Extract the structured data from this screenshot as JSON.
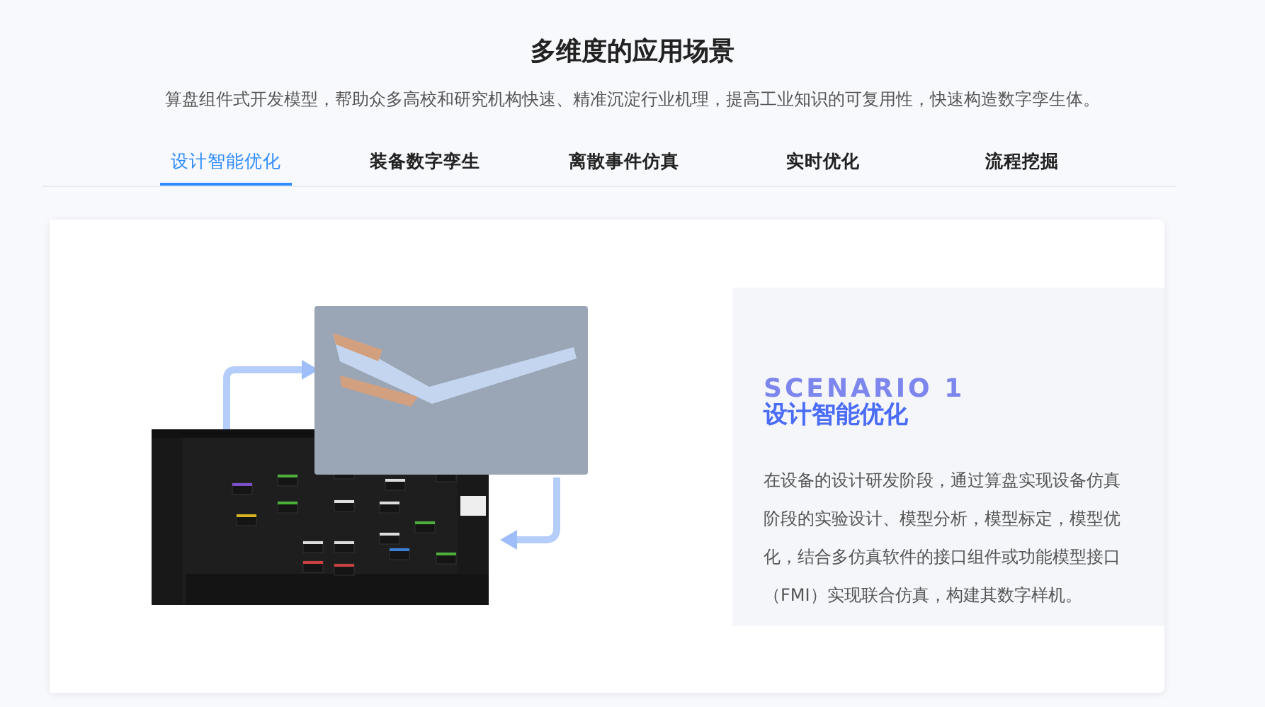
{
  "section": {
    "title": "多维度的应用场景",
    "subtitle": "算盘组件式开发模型，帮助众多高校和研究机构快速、精准沉淀行业机理，提高工业知识的可复用性，快速构造数字孪生体。"
  },
  "tabs": [
    {
      "label": "设计智能优化",
      "selected": true
    },
    {
      "label": "装备数字孪生",
      "selected": false
    },
    {
      "label": "离散事件仿真",
      "selected": false
    },
    {
      "label": "实时优化",
      "selected": false
    },
    {
      "label": "流程挖掘",
      "selected": false
    }
  ],
  "scenario": {
    "label": "SCENARIO 1",
    "title": "设计智能优化",
    "description": "在设备的设计研发阶段，通过算盘实现设备仿真阶段的实验设计、模型分析，模型标定，模型优化，结合多仿真软件的接口组件或功能模型接口（FMI）实现联合仿真，构建其数字样机。"
  }
}
